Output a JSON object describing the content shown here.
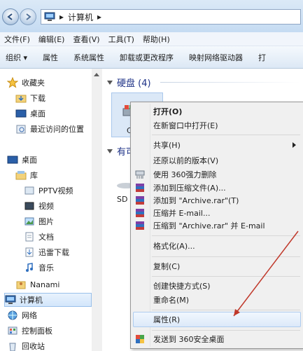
{
  "address": {
    "breadcrumb_root": "▸",
    "location": "计算机"
  },
  "menubar": [
    {
      "label": "文件(F)"
    },
    {
      "label": "编辑(E)"
    },
    {
      "label": "查看(V)"
    },
    {
      "label": "工具(T)"
    },
    {
      "label": "帮助(H)"
    }
  ],
  "cmdbar": {
    "organize": "组织 ▾",
    "items": [
      {
        "label": "属性"
      },
      {
        "label": "系统属性"
      },
      {
        "label": "卸载或更改程序"
      },
      {
        "label": "映射网络驱动器"
      },
      {
        "label": "打"
      }
    ]
  },
  "navpane": {
    "favorites": "收藏夹",
    "favorites_items": [
      "下载",
      "桌面",
      "最近访问的位置"
    ],
    "desktop": "桌面",
    "library": "库",
    "library_items": [
      "PPTV视频",
      "视频",
      "图片",
      "文档",
      "迅雷下载",
      "音乐"
    ],
    "user": "Nanami",
    "computer": "计算机",
    "network": "网络",
    "control_panel": "控制面板",
    "recycle_bin": "回收站"
  },
  "content": {
    "hard_disk_group": "硬盘 (4)",
    "removable_group": "有可",
    "drive_label": "C",
    "sd_label": "SD"
  },
  "context_menu": {
    "open": "打开(O)",
    "open_new_window": "在新窗口中打开(E)",
    "share": "共享(H)",
    "restore_versions": "还原以前的版本(V)",
    "force_delete_360": "使用 360强力删除",
    "add_to_archive": "添加到压缩文件(A)...",
    "add_to_archive_rar": "添加到 \"Archive.rar\"(T)",
    "compress_email": "压缩并 E-mail...",
    "compress_rar_email": "压缩到 \"Archive.rar\" 并 E-mail",
    "format": "格式化(A)...",
    "copy": "复制(C)",
    "create_shortcut": "创建快捷方式(S)",
    "rename": "重命名(M)",
    "properties": "属性(R)",
    "send_to_360_desktop": "发送到 360安全桌面"
  },
  "colors": {
    "accent": "#1e3287",
    "highlight": "#dce9f9",
    "annotation_arrow": "#c0392b"
  }
}
